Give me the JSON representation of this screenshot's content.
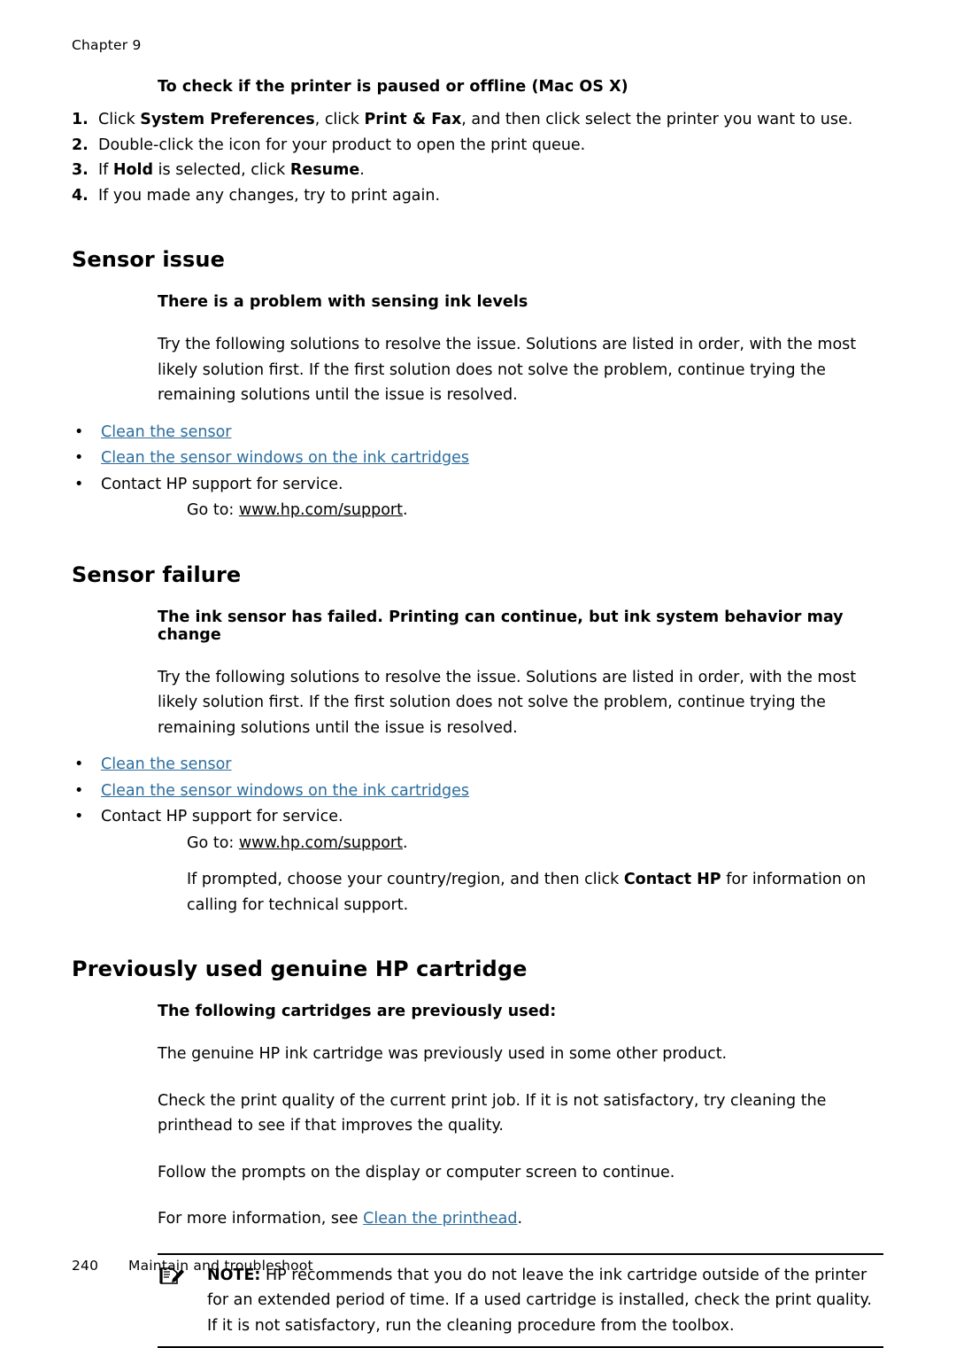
{
  "header": {
    "chapter": "Chapter 9"
  },
  "sections": {
    "mac_check": {
      "heading": "To check if the printer is paused or offline (Mac OS X)",
      "steps": [
        {
          "num": "1.",
          "parts": [
            {
              "text": "Click ",
              "bold": false
            },
            {
              "text": "System Preferences",
              "bold": true
            },
            {
              "text": ", click ",
              "bold": false
            },
            {
              "text": "Print & Fax",
              "bold": true
            },
            {
              "text": ", and then click select the printer you want to use.",
              "bold": false
            }
          ]
        },
        {
          "num": "2.",
          "parts": [
            {
              "text": "Double-click the icon for your product to open the print queue.",
              "bold": false
            }
          ]
        },
        {
          "num": "3.",
          "parts": [
            {
              "text": "If  ",
              "bold": false
            },
            {
              "text": "Hold",
              "bold": true
            },
            {
              "text": " is selected, click ",
              "bold": false
            },
            {
              "text": "Resume",
              "bold": true
            },
            {
              "text": ".",
              "bold": false
            }
          ]
        },
        {
          "num": "4.",
          "parts": [
            {
              "text": "If you made any changes, try to print again.",
              "bold": false
            }
          ]
        }
      ]
    },
    "sensor_issue": {
      "title": "Sensor issue",
      "subtitle": "There is a problem with sensing ink levels",
      "paragraph": "Try the following solutions to resolve the issue. Solutions are listed in order, with the most likely solution first. If the first solution does not solve the problem, continue trying the remaining solutions until the issue is resolved.",
      "bullets": [
        {
          "text": "Clean the sensor",
          "link": true
        },
        {
          "text": "Clean the sensor windows on the ink cartridges",
          "link": true
        },
        {
          "text": "Contact HP support for service.",
          "link": false
        }
      ],
      "goto_prefix": "Go to: ",
      "goto_url": "www.hp.com/support",
      "goto_suffix": "."
    },
    "sensor_failure": {
      "title": "Sensor failure",
      "subtitle": "The ink sensor has failed. Printing can continue, but ink system behavior may change",
      "paragraph": "Try the following solutions to resolve the issue. Solutions are listed in order, with the most likely solution first. If the first solution does not solve the problem, continue trying the remaining solutions until the issue is resolved.",
      "bullets": [
        {
          "text": "Clean the sensor",
          "link": true
        },
        {
          "text": "Clean the sensor windows on the ink cartridges",
          "link": true
        },
        {
          "text": "Contact HP support for service.",
          "link": false
        }
      ],
      "goto_prefix": "Go to: ",
      "goto_url": "www.hp.com/support",
      "goto_suffix": ".",
      "closing_parts": [
        {
          "text": "If prompted, choose your country/region, and then click ",
          "bold": false
        },
        {
          "text": "Contact HP",
          "bold": true
        },
        {
          "text": " for information on calling for technical support.",
          "bold": false
        }
      ]
    },
    "previously_used": {
      "title": "Previously used genuine HP cartridge",
      "subtitle": "The following cartridges are previously used:",
      "paragraphs": [
        "The genuine HP ink cartridge was previously used in some other product.",
        "Check the print quality of the current print job. If it is not satisfactory, try cleaning the printhead to see if that improves the quality.",
        "Follow the prompts on the display or computer screen to continue."
      ],
      "more_info_prefix": "For more information, see ",
      "more_info_link": "Clean the printhead",
      "more_info_suffix": ".",
      "note": {
        "icon": "note-pencil-icon",
        "label": "NOTE:",
        "text": "  HP recommends that you do not leave the ink cartridge outside of the printer for an extended period of time. If a used cartridge is installed, check the print quality. If it is not satisfactory, run the cleaning procedure from the toolbox."
      }
    }
  },
  "footer": {
    "page_number": "240",
    "title": "Maintain and troubleshoot"
  },
  "colors": {
    "link": "#2b6d9e",
    "text": "#000000",
    "background": "#ffffff"
  }
}
